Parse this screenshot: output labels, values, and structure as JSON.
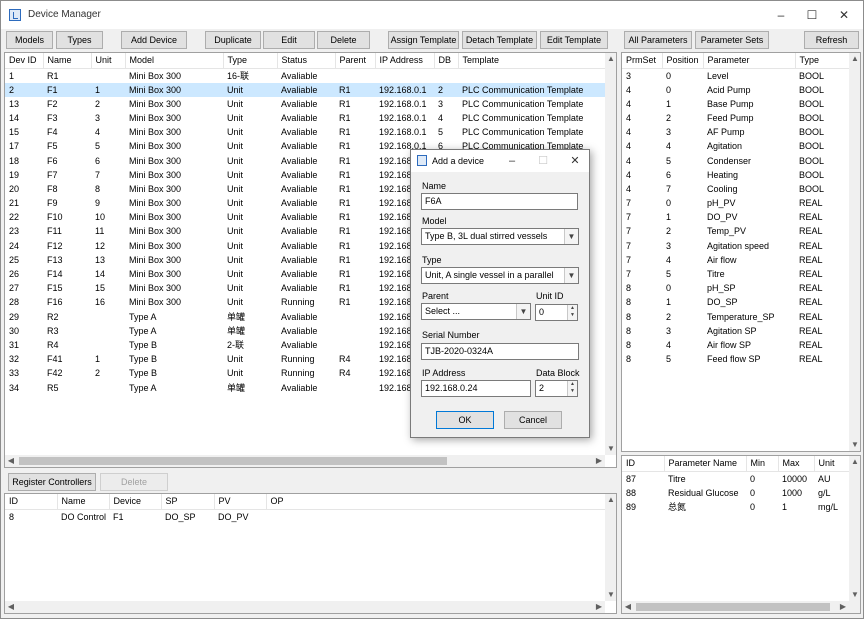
{
  "window": {
    "title": "Device Manager"
  },
  "toolbar": {
    "models": "Models",
    "types": "Types",
    "add_device": "Add Device",
    "duplicate": "Duplicate",
    "edit": "Edit",
    "delete": "Delete",
    "assign_template": "Assign Template",
    "detach_template": "Detach Template",
    "edit_template": "Edit Template",
    "all_parameters": "All Parameters",
    "parameter_sets": "Parameter Sets",
    "refresh": "Refresh"
  },
  "devices": {
    "columns": [
      "Dev ID",
      "Name",
      "Unit",
      "Model",
      "Type",
      "Status",
      "Parent",
      "IP Address",
      "DB",
      "Template"
    ],
    "selected_index": 1,
    "rows": [
      [
        "1",
        "R1",
        "",
        "Mini Box 300",
        "16-联",
        "Avaliable",
        "",
        "",
        "",
        ""
      ],
      [
        "2",
        "F1",
        "1",
        "Mini Box 300",
        "Unit",
        "Avaliable",
        "R1",
        "192.168.0.1",
        "2",
        "PLC Communication Template"
      ],
      [
        "13",
        "F2",
        "2",
        "Mini Box 300",
        "Unit",
        "Avaliable",
        "R1",
        "192.168.0.1",
        "3",
        "PLC Communication Template"
      ],
      [
        "14",
        "F3",
        "3",
        "Mini Box 300",
        "Unit",
        "Avaliable",
        "R1",
        "192.168.0.1",
        "4",
        "PLC Communication Template"
      ],
      [
        "15",
        "F4",
        "4",
        "Mini Box 300",
        "Unit",
        "Avaliable",
        "R1",
        "192.168.0.1",
        "5",
        "PLC Communication Template"
      ],
      [
        "17",
        "F5",
        "5",
        "Mini Box 300",
        "Unit",
        "Avaliable",
        "R1",
        "192.168.0.1",
        "6",
        "PLC Communication Template"
      ],
      [
        "18",
        "F6",
        "6",
        "Mini Box 300",
        "Unit",
        "Avaliable",
        "R1",
        "192.168.",
        "",
        ""
      ],
      [
        "19",
        "F7",
        "7",
        "Mini Box 300",
        "Unit",
        "Avaliable",
        "R1",
        "192.168.",
        "",
        ""
      ],
      [
        "20",
        "F8",
        "8",
        "Mini Box 300",
        "Unit",
        "Avaliable",
        "R1",
        "192.168.",
        "",
        ""
      ],
      [
        "21",
        "F9",
        "9",
        "Mini Box 300",
        "Unit",
        "Avaliable",
        "R1",
        "192.168.",
        "",
        ""
      ],
      [
        "22",
        "F10",
        "10",
        "Mini Box 300",
        "Unit",
        "Avaliable",
        "R1",
        "192.168.",
        "",
        ""
      ],
      [
        "23",
        "F11",
        "11",
        "Mini Box 300",
        "Unit",
        "Avaliable",
        "R1",
        "192.168.",
        "",
        ""
      ],
      [
        "24",
        "F12",
        "12",
        "Mini Box 300",
        "Unit",
        "Avaliable",
        "R1",
        "192.168.",
        "",
        ""
      ],
      [
        "25",
        "F13",
        "13",
        "Mini Box 300",
        "Unit",
        "Avaliable",
        "R1",
        "192.168.",
        "",
        ""
      ],
      [
        "26",
        "F14",
        "14",
        "Mini Box 300",
        "Unit",
        "Avaliable",
        "R1",
        "192.168.",
        "",
        ""
      ],
      [
        "27",
        "F15",
        "15",
        "Mini Box 300",
        "Unit",
        "Avaliable",
        "R1",
        "192.168.",
        "",
        ""
      ],
      [
        "28",
        "F16",
        "16",
        "Mini Box 300",
        "Unit",
        "Running",
        "R1",
        "192.168.",
        "",
        ""
      ],
      [
        "29",
        "R2",
        "",
        "Type A",
        "单罐",
        "Avaliable",
        "",
        "192.168.",
        "",
        ""
      ],
      [
        "30",
        "R3",
        "",
        "Type A",
        "单罐",
        "Avaliable",
        "",
        "192.168.",
        "",
        ""
      ],
      [
        "31",
        "R4",
        "",
        "Type B",
        "2-联",
        "Avaliable",
        "",
        "192.168.",
        "",
        ""
      ],
      [
        "32",
        "F41",
        "1",
        "Type B",
        "Unit",
        "Running",
        "R4",
        "192.168.",
        "",
        ""
      ],
      [
        "33",
        "F42",
        "2",
        "Type B",
        "Unit",
        "Running",
        "R4",
        "192.168.",
        "",
        ""
      ],
      [
        "34",
        "R5",
        "",
        "Type A",
        "单罐",
        "Avaliable",
        "",
        "192.168.",
        "",
        ""
      ]
    ]
  },
  "controllers": {
    "register_label": "Register Controllers",
    "delete_label": "Delete",
    "columns": [
      "ID",
      "Name",
      "Device",
      "SP",
      "PV",
      "OP"
    ],
    "rows": [
      [
        "8",
        "DO Control",
        "F1",
        "DO_SP",
        "DO_PV",
        ""
      ]
    ]
  },
  "parameters": {
    "columns": [
      "PrmSet",
      "Position",
      "Parameter",
      "Type"
    ],
    "rows": [
      [
        "3",
        "0",
        "Level",
        "BOOL"
      ],
      [
        "4",
        "0",
        "Acid Pump",
        "BOOL"
      ],
      [
        "4",
        "1",
        "Base Pump",
        "BOOL"
      ],
      [
        "4",
        "2",
        "Feed Pump",
        "BOOL"
      ],
      [
        "4",
        "3",
        "AF Pump",
        "BOOL"
      ],
      [
        "4",
        "4",
        "Agitation",
        "BOOL"
      ],
      [
        "4",
        "5",
        "Condenser",
        "BOOL"
      ],
      [
        "4",
        "6",
        "Heating",
        "BOOL"
      ],
      [
        "4",
        "7",
        "Cooling",
        "BOOL"
      ],
      [
        "7",
        "0",
        "pH_PV",
        "REAL"
      ],
      [
        "7",
        "1",
        "DO_PV",
        "REAL"
      ],
      [
        "7",
        "2",
        "Temp_PV",
        "REAL"
      ],
      [
        "7",
        "3",
        "Agitation speed",
        "REAL"
      ],
      [
        "7",
        "4",
        "Air flow",
        "REAL"
      ],
      [
        "7",
        "5",
        "Titre",
        "REAL"
      ],
      [
        "8",
        "0",
        "pH_SP",
        "REAL"
      ],
      [
        "8",
        "1",
        "DO_SP",
        "REAL"
      ],
      [
        "8",
        "2",
        "Temperature_SP",
        "REAL"
      ],
      [
        "8",
        "3",
        "Agitation SP",
        "REAL"
      ],
      [
        "8",
        "4",
        "Air flow SP",
        "REAL"
      ],
      [
        "8",
        "5",
        "Feed flow SP",
        "REAL"
      ]
    ]
  },
  "param_defs": {
    "columns": [
      "ID",
      "Parameter Name",
      "Min",
      "Max",
      "Unit"
    ],
    "rows": [
      [
        "87",
        "Titre",
        "0",
        "10000",
        "AU"
      ],
      [
        "88",
        "Residual Glucose",
        "0",
        "1000",
        "g/L"
      ],
      [
        "89",
        "总氮",
        "0",
        "1",
        "mg/L"
      ]
    ]
  },
  "dialog": {
    "title": "Add a device",
    "name_label": "Name",
    "name_value": "F6A",
    "model_label": "Model",
    "model_value": "Type B, 3L dual stirred vessels",
    "type_label": "Type",
    "type_value": "Unit, A single vessel in a parallel",
    "parent_label": "Parent",
    "parent_value": "Select ...",
    "unit_id_label": "Unit ID",
    "unit_id_value": "0",
    "serial_label": "Serial Number",
    "serial_value": "TJB-2020-0324A",
    "ip_label": "IP Address",
    "ip_value": "192.168.0.24",
    "db_label": "Data Block",
    "db_value": "2",
    "ok_label": "OK",
    "cancel_label": "Cancel"
  }
}
